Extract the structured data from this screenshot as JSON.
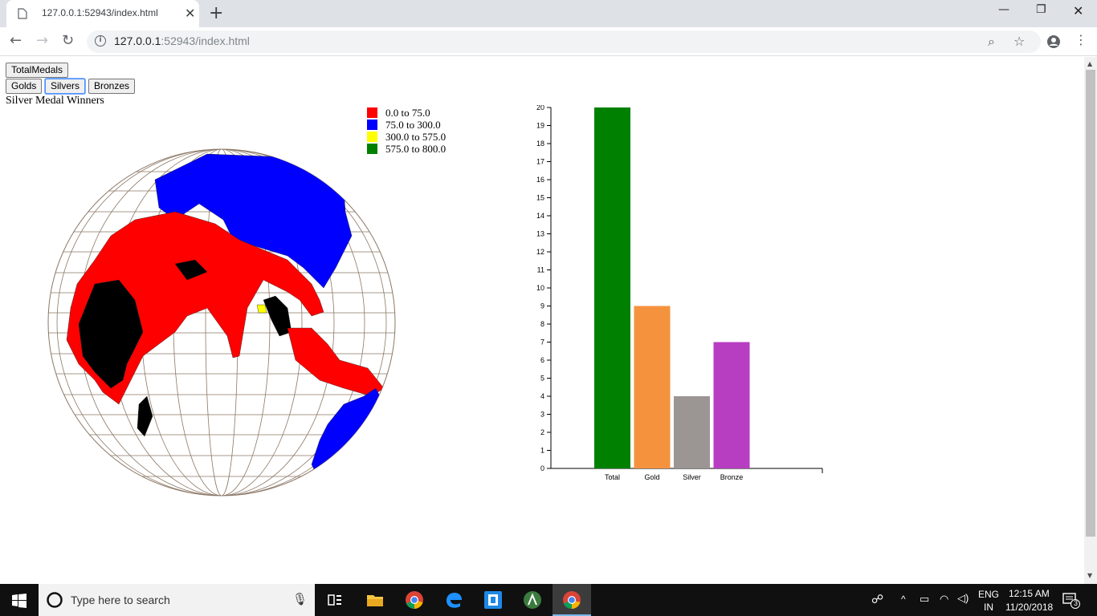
{
  "browser": {
    "tab_title": "127.0.0.1:52943/index.html",
    "url_host": "127.0.0.1",
    "url_rest": ":52943/index.html"
  },
  "page": {
    "buttons_row1": [
      "TotalMedals"
    ],
    "buttons_row2": [
      "Golds",
      "Silvers",
      "Bronzes"
    ],
    "active_button": "Silvers",
    "heading": "Silver Medal Winners",
    "legend": [
      {
        "label": "0.0 to 75.0",
        "color": "#ff0000"
      },
      {
        "label": "75.0 to 300.0",
        "color": "#0000ff"
      },
      {
        "label": "300.0 to 575.0",
        "color": "#ffff00"
      },
      {
        "label": "575.0 to 800.0",
        "color": "#008000"
      }
    ]
  },
  "chart_data": {
    "type": "bar",
    "categories": [
      "Total",
      "Gold",
      "Silver",
      "Bronze"
    ],
    "values": [
      20,
      9,
      4,
      7
    ],
    "colors": [
      "#008000",
      "#f5923e",
      "#9b9594",
      "#b73dc1"
    ],
    "ylim": [
      0,
      20
    ],
    "yticks": [
      0,
      1,
      2,
      3,
      4,
      5,
      6,
      7,
      8,
      9,
      10,
      11,
      12,
      13,
      14,
      15,
      16,
      17,
      18,
      19,
      20
    ],
    "title": "",
    "xlabel": "",
    "ylabel": ""
  },
  "taskbar": {
    "search_placeholder": "Type here to search",
    "lang1": "ENG",
    "lang2": "IN",
    "time": "12:15 AM",
    "date": "11/20/2018",
    "notif_count": "3"
  }
}
